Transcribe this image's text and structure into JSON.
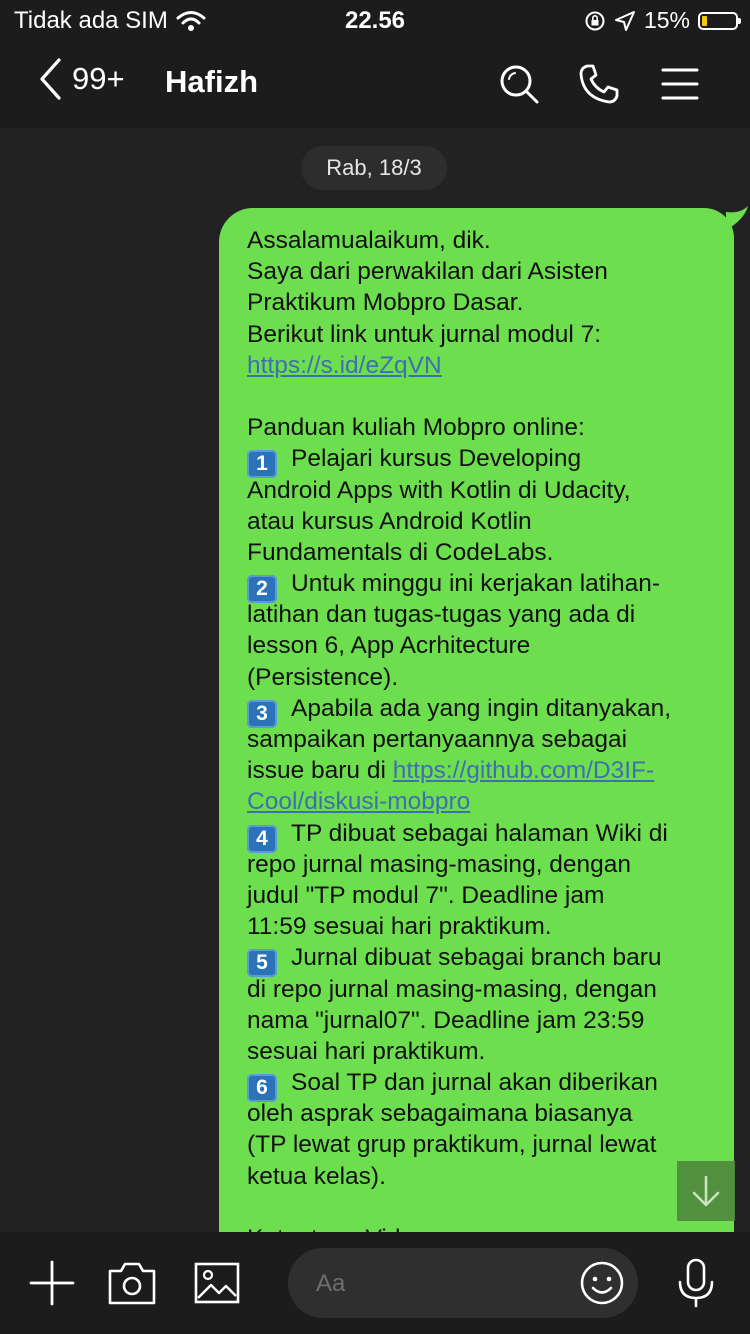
{
  "status_bar": {
    "carrier": "Tidak ada SIM",
    "time": "22.56",
    "battery_percent": "15%",
    "battery_level": 0.15,
    "battery_color": "#f5c518"
  },
  "header": {
    "back_icon": "chevron-left-icon",
    "unread_count": "99+",
    "contact_name": "Hafizh",
    "actions": [
      "search-icon",
      "phone-icon",
      "menu-icon"
    ]
  },
  "chat": {
    "date_label": "Rab, 18/3",
    "bubble_color": "#6ddf4f",
    "message_lines": [
      "Assalamualaikum, dik.",
      "Saya dari perwakilan dari Asisten",
      "Praktikum Mobpro Dasar.",
      "Berikut link untuk jurnal modul 7:",
      "https://s.id/eZqVN",
      "",
      "Panduan kuliah Mobpro online:",
      "Pelajari kursus Developing",
      "Android Apps with Kotlin di Udacity,",
      "atau kursus Android Kotlin",
      "Fundamentals di CodeLabs.",
      "Untuk minggu ini kerjakan latihan-",
      "latihan dan tugas-tugas yang ada di",
      "lesson 6, App Acrhitecture",
      "(Persistence).",
      "Apabila ada yang ingin ditanyakan,",
      "sampaikan pertanyaannya sebagai",
      "issue baru di ",
      "https://github.com/D3IF-",
      "Cool/diskusi-mobpro",
      "TP dibuat sebagai halaman Wiki di",
      "repo jurnal masing-masing, dengan",
      "judul \"TP modul 7\". Deadline jam",
      "11:59 sesuai hari praktikum.",
      "Jurnal dibuat sebagai branch baru",
      "di repo jurnal masing-masing, dengan",
      "nama \"jurnal07\". Deadline jam 23:59",
      "sesuai hari praktikum.",
      "Soal TP dan jurnal akan diberikan",
      "oleh asprak sebagaimana biasanya",
      "(TP lewat grup praktikum, jurnal lewat",
      "ketua kelas).",
      "",
      "Ketentuan Video:"
    ],
    "list_numbers": [
      "1",
      "2",
      "3",
      "4",
      "5",
      "6"
    ],
    "scroll_icon": "arrow-down-icon"
  },
  "input_bar": {
    "icons": [
      "plus-icon",
      "camera-icon",
      "image-icon",
      "smiley-icon",
      "microphone-icon"
    ],
    "placeholder": "Aa"
  }
}
